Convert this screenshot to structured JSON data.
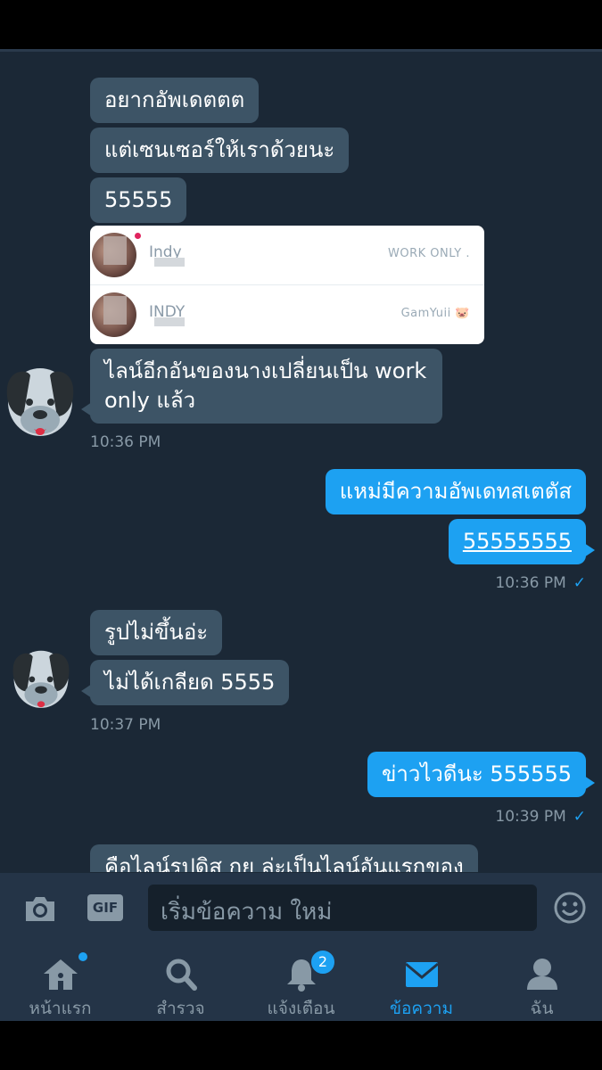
{
  "conversation": {
    "messages_group1": [
      {
        "text": "อยากอัพเดตตต"
      },
      {
        "text": "แต่เซนเซอร์ให้เราด้วยนะ"
      },
      {
        "text": "55555"
      }
    ],
    "shared_screenshot": {
      "rows": [
        {
          "name": "Indy",
          "right": "WORK ONLY ."
        },
        {
          "name": "INDY",
          "right": "GamYuii 🐷"
        }
      ]
    },
    "message_group1_last": "ไลน์อีกอันของนางเปลี่ยนเป็น work only แล้ว",
    "time1": "10:36 PM",
    "outgoing1": [
      "แหม่มีความอัพเดทสเตตัส",
      "55555555"
    ],
    "time2": "10:36 PM",
    "messages_group2": [
      "รูปไม่ขึ้นอ่ะ",
      "ไม่ได้เกลียด 5555"
    ],
    "time3": "10:37 PM",
    "outgoing2": "ข่าวไวดีนะ 555555",
    "time4": "10:39 PM",
    "partial_message": "คือไลน์รูปดิส กุย ล่ะเป็นไลน์อันแรกของ",
    "read_check": "✓"
  },
  "composer": {
    "gif_label": "GIF",
    "placeholder": "เริ่มข้อความ ใหม่"
  },
  "tabs": [
    {
      "label": "หน้าแรก",
      "icon": "home-icon"
    },
    {
      "label": "สำรวจ",
      "icon": "search-icon"
    },
    {
      "label": "แจ้งเตือน",
      "icon": "bell-icon"
    },
    {
      "label": "ข้อความ",
      "icon": "mail-icon"
    },
    {
      "label": "ฉัน",
      "icon": "profile-icon"
    }
  ],
  "notification_badge": "2",
  "colors": {
    "accent": "#1da1f2",
    "background": "#1b2836",
    "incoming": "#3d5466"
  }
}
